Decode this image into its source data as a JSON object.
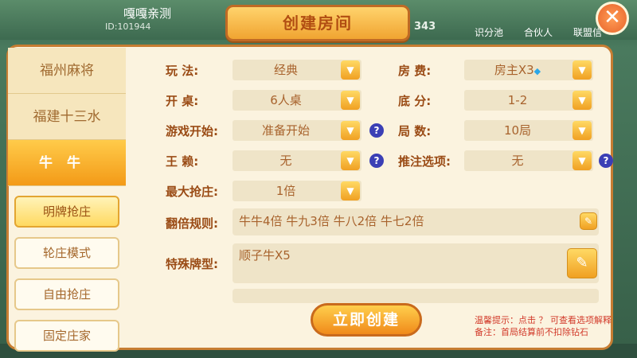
{
  "background": {
    "player_name": "嘎嘎亲测",
    "player_id": "ID:101944",
    "counter": "343",
    "right_items": [
      "识分池",
      "合伙人",
      "联盟信"
    ]
  },
  "dialog": {
    "title": "创建房间",
    "close_icon": "close-icon",
    "categories": [
      {
        "label": "福州麻将",
        "active": false
      },
      {
        "label": "福建十三水",
        "active": false
      },
      {
        "label": "牛牛",
        "active": true
      }
    ],
    "sub_modes": [
      {
        "label": "明牌抢庄",
        "active": true
      },
      {
        "label": "轮庄模式",
        "active": false
      },
      {
        "label": "自由抢庄",
        "active": false
      },
      {
        "label": "固定庄家",
        "active": false
      }
    ],
    "fields": {
      "play": {
        "label": "玩    法:",
        "value": "经典"
      },
      "room_fee": {
        "label": "房    费:",
        "value": "房主X3",
        "icon": "diamond-icon"
      },
      "tables": {
        "label": "开    桌:",
        "value": "6人桌"
      },
      "base_score": {
        "label": "底    分:",
        "value": "1-2"
      },
      "game_start": {
        "label": "游戏开始:",
        "value": "准备开始"
      },
      "rounds": {
        "label": "局    数:",
        "value": "10局"
      },
      "wildcard": {
        "label": "王    赖:",
        "value": "无"
      },
      "push_bet": {
        "label": "推注选项:",
        "value": "无"
      },
      "max_grab": {
        "label": "最大抢庄:",
        "value": "1倍"
      },
      "double_rules": {
        "label": "翻倍规则:",
        "value": "牛牛4倍 牛九3倍 牛八2倍 牛七2倍"
      },
      "special": {
        "label": "特殊牌型:",
        "value": "顺子牛X5"
      }
    },
    "help_symbol": "?",
    "create_button": "立即创建",
    "tips": {
      "line1": "温馨提示：点击 ？ 可查看选项解释",
      "line2": "备注：首局结算前不扣除钻石"
    }
  },
  "colors": {
    "accent": "#f39a17",
    "label": "#9a4b15",
    "value": "#a8632d",
    "tip": "#d23a2a"
  }
}
